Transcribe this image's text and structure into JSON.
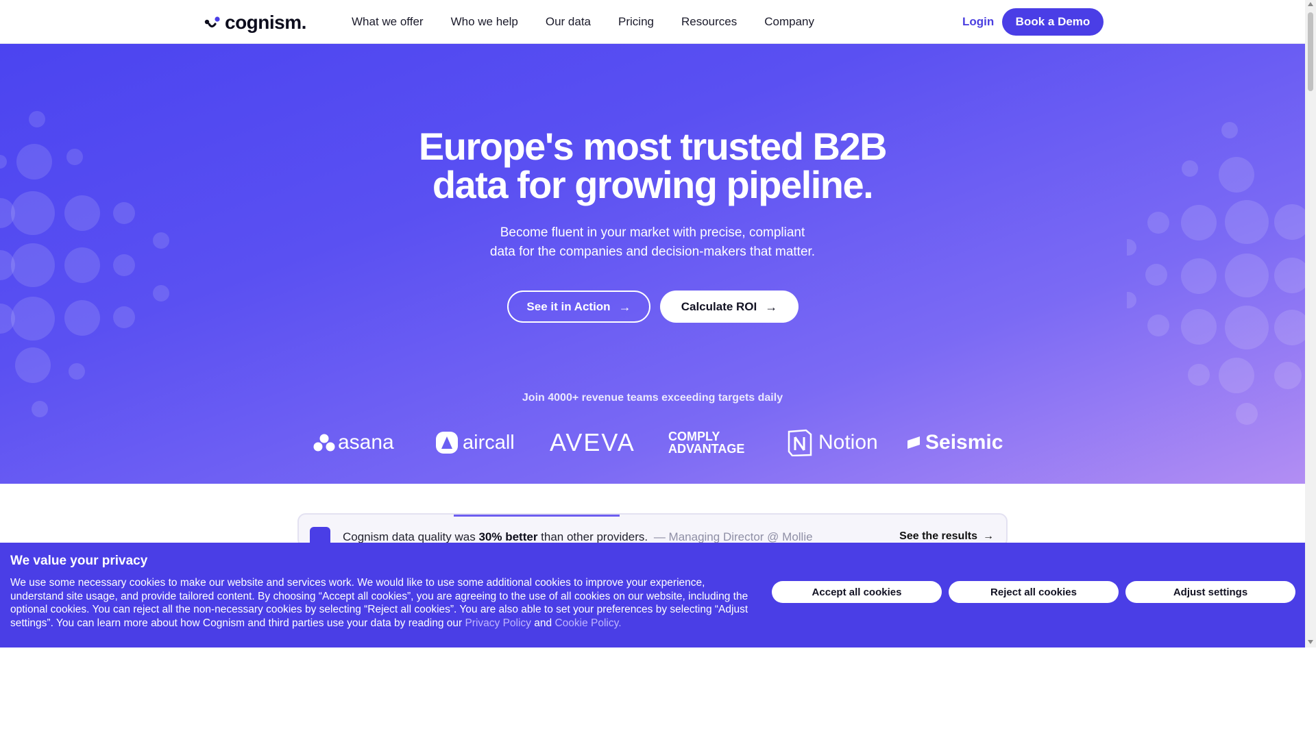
{
  "header": {
    "logo_text": "cognism.",
    "nav": [
      "What we offer",
      "Who we help",
      "Our data",
      "Pricing",
      "Resources",
      "Company"
    ],
    "login": "Login",
    "cta": "Book a Demo"
  },
  "hero": {
    "title_line1": "Europe's most trusted B2B",
    "title_line2": "data for growing pipeline.",
    "subtitle_line1": "Become fluent in your market with precise, compliant",
    "subtitle_line2": "data for the companies and decision-makers that matter.",
    "primary_button": "See it in Action",
    "secondary_button": "Calculate ROI",
    "social_proof": "Join 4000+ revenue teams exceeding targets daily",
    "brands": [
      "asana",
      "aircall",
      "AVEVA",
      "COMPLY ADVANTAGE",
      "Notion",
      "Seismic"
    ]
  },
  "testimonial": {
    "text_before": "Cognism data quality was",
    "text_bold": "30% better",
    "text_after": "than other providers.",
    "author": "— Managing Director @ Mollie",
    "link": "See the results"
  },
  "cookie_banner": {
    "title": "We value your privacy",
    "body": "We use some necessary cookies to make our website and services work. We would like to use some additional cookies to improve your experience, understand site usage, and provide tailored content. By choosing “Accept all cookies”, you are agreeing to the use of all cookies on our website, including the optional cookies. You can reject all the non-necessary cookies by selecting “Reject all cookies”. You are also able to set your preferences by selecting “Adjust settings”. You can learn more about how Cognism and third parties use your data by reading our",
    "privacy_link": "Privacy Policy",
    "and": "and",
    "cookie_link": "Cookie Policy.",
    "accept": "Accept all cookies",
    "reject": "Reject all cookies",
    "adjust": "Adjust settings"
  },
  "colors": {
    "brand": "#4a3ee6",
    "hero_start": "#4b44f0",
    "hero_end": "#b28ef3",
    "link": "#bfb5ff"
  }
}
